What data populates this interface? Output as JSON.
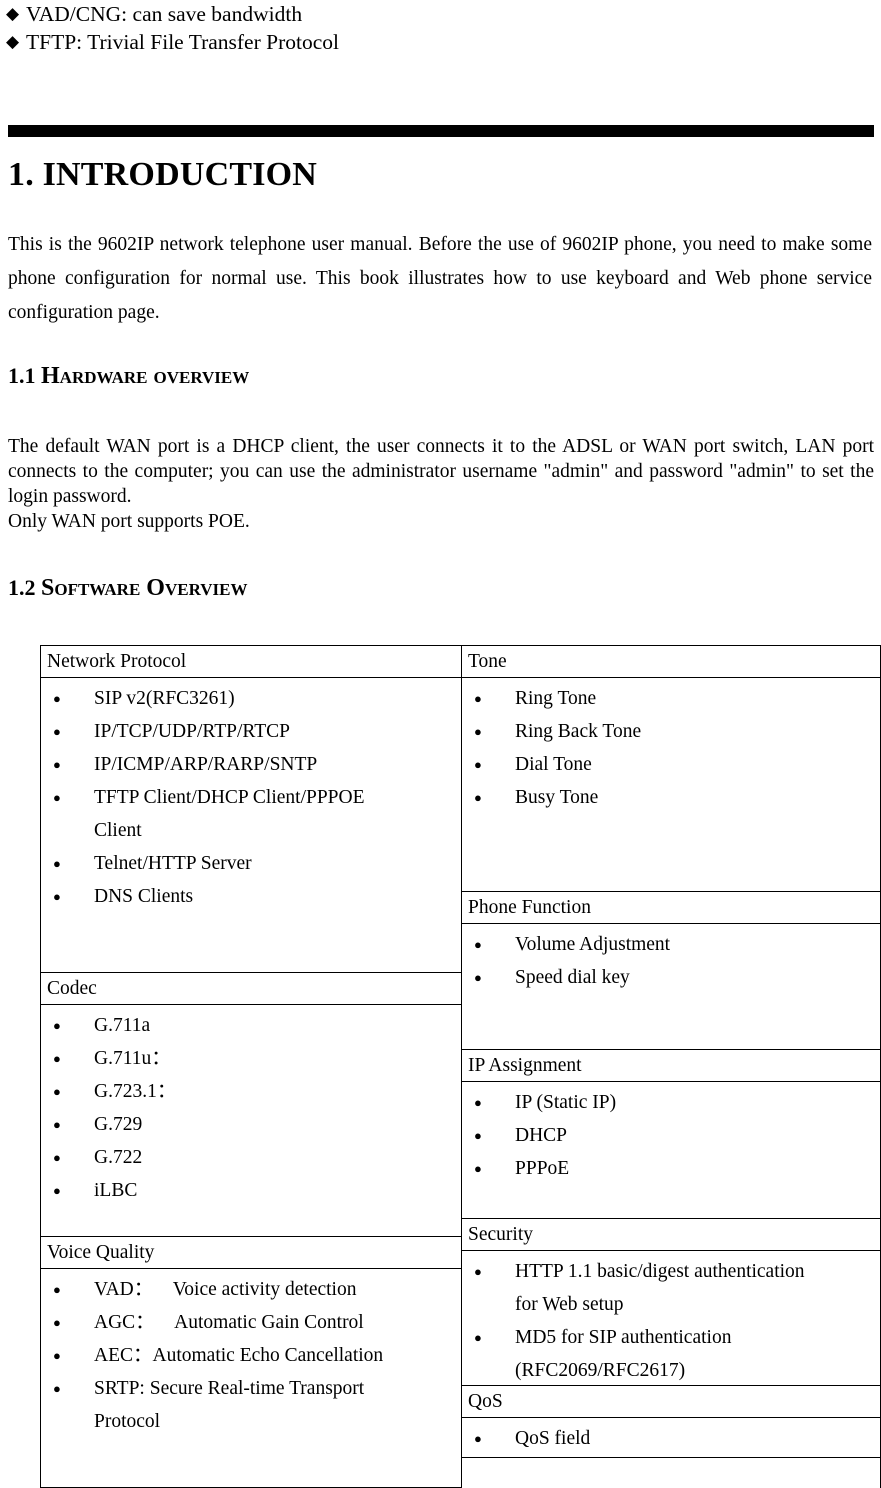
{
  "top_list": {
    "bullet_glyph": "◆",
    "items": [
      "VAD/CNG: can save bandwidth",
      "TFTP: Trivial File Transfer Protocol"
    ]
  },
  "section": {
    "heading": "1. INTRODUCTION",
    "intro_paragraph": "This is the 9602IP network telephone user manual. Before the use of 9602IP phone, you need to make some phone configuration for normal use. This book illustrates how to use keyboard and Web phone service configuration page."
  },
  "subsections": {
    "hardware": {
      "number": "1.1",
      "title": "Hardware overview",
      "paragraph": "The default WAN port is a DHCP client, the user connects it to the ADSL or WAN port switch, LAN port connects to the computer; you can use the administrator username \"admin\" and password \"admin\" to set the login password.",
      "paragraph_line2": "Only WAN port supports POE."
    },
    "software": {
      "number": "1.2",
      "title": "Software Overview"
    }
  },
  "spec_table": {
    "bullet_glyph": "●",
    "left_column": [
      {
        "header": "Network Protocol",
        "items": [
          "SIP v2(RFC3261)",
          "IP/TCP/UDP/RTP/RTCP",
          "IP/ICMP/ARP/RARP/SNTP",
          "TFTP Client/DHCP Client/PPPOE",
          "Telnet/HTTP Server",
          "DNS Clients"
        ],
        "continuation_after_index_3": "Client"
      },
      {
        "header": "Codec",
        "items": [
          "G.711a",
          "G.711u：",
          "G.723.1：",
          "G.729",
          "G.722",
          "iLBC"
        ]
      },
      {
        "header": "Voice Quality",
        "items": [
          "VAD： Voice activity detection",
          "AGC： Automatic Gain Control",
          "AEC：Automatic Echo Cancellation",
          "SRTP: Secure Real-time Transport"
        ],
        "continuation_after_index_3": "Protocol"
      }
    ],
    "right_column": [
      {
        "header": "Tone",
        "items": [
          "Ring Tone",
          "Ring Back Tone",
          "Dial Tone",
          "Busy Tone"
        ]
      },
      {
        "header": "Phone Function",
        "items": [
          "Volume Adjustment",
          "Speed dial key"
        ]
      },
      {
        "header": "IP Assignment",
        "items": [
          "IP (Static IP)",
          "DHCP",
          "PPPoE"
        ]
      },
      {
        "header": "Security",
        "items": [
          "HTTP 1.1 basic/digest authentication",
          "MD5 for SIP authentication"
        ],
        "continuation_after_index_0": "for Web setup",
        "continuation_after_index_1": "(RFC2069/RFC2617)"
      },
      {
        "header": "QoS",
        "items": [
          "QoS field"
        ]
      }
    ]
  }
}
